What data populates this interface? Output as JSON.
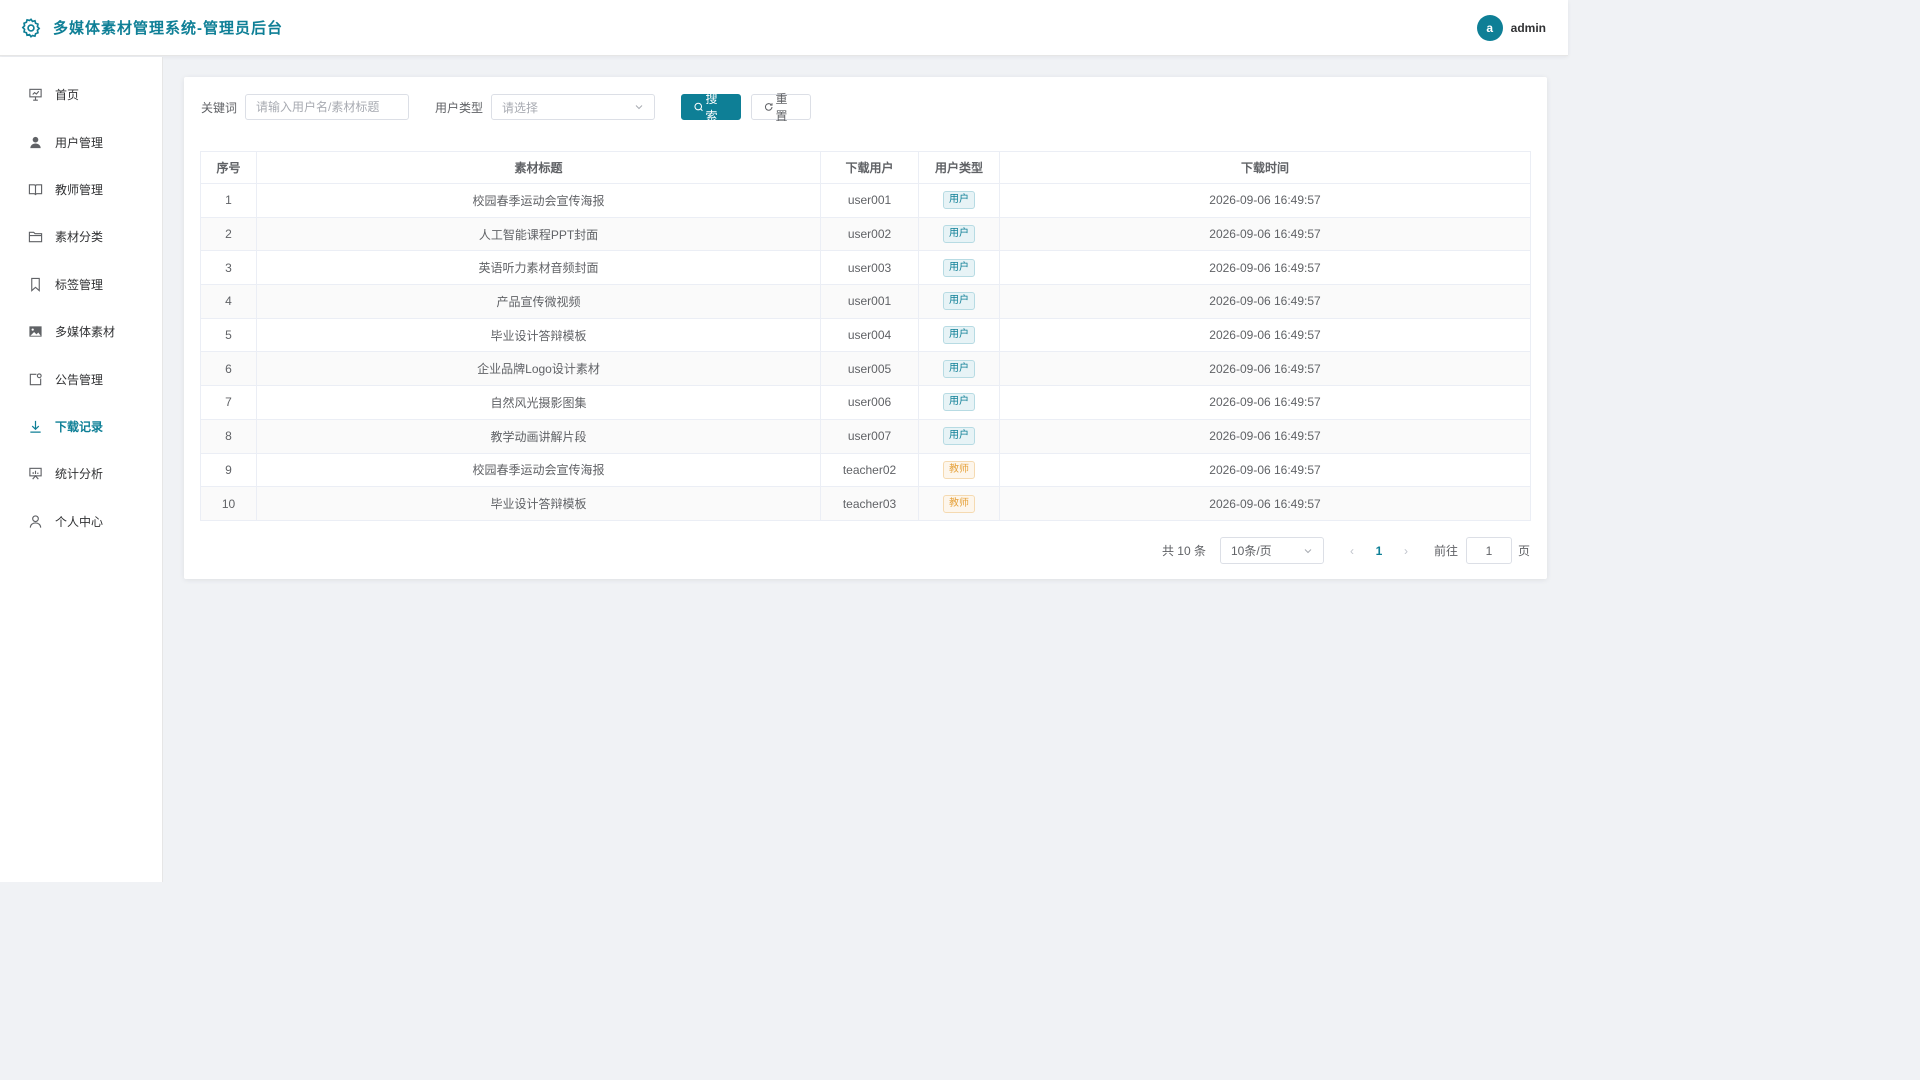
{
  "header": {
    "title": "多媒体素材管理系统-管理员后台",
    "avatar_letter": "a",
    "username": "admin"
  },
  "sidebar": {
    "items": [
      {
        "label": "首页",
        "icon": "presentation-icon"
      },
      {
        "label": "用户管理",
        "icon": "user-icon"
      },
      {
        "label": "教师管理",
        "icon": "book-icon"
      },
      {
        "label": "素材分类",
        "icon": "folder-icon"
      },
      {
        "label": "标签管理",
        "icon": "bookmark-icon"
      },
      {
        "label": "多媒体素材",
        "icon": "image-icon"
      },
      {
        "label": "公告管理",
        "icon": "notice-icon"
      },
      {
        "label": "下载记录",
        "icon": "download-icon",
        "active": true
      },
      {
        "label": "统计分析",
        "icon": "chart-icon"
      },
      {
        "label": "个人中心",
        "icon": "person-icon"
      }
    ]
  },
  "filter": {
    "keyword_label": "关键词",
    "keyword_placeholder": "请输入用户名/素材标题",
    "usertype_label": "用户类型",
    "usertype_placeholder": "请选择",
    "search_label": "搜索",
    "reset_label": "重置"
  },
  "table": {
    "columns": [
      "序号",
      "素材标题",
      "下载用户",
      "用户类型",
      "下载时间"
    ],
    "rows": [
      {
        "index": "1",
        "title": "校园春季运动会宣传海报",
        "user": "user001",
        "type": "用户",
        "time": "2026-09-06 16:49:57"
      },
      {
        "index": "2",
        "title": "人工智能课程PPT封面",
        "user": "user002",
        "type": "用户",
        "time": "2026-09-06 16:49:57"
      },
      {
        "index": "3",
        "title": "英语听力素材音频封面",
        "user": "user003",
        "type": "用户",
        "time": "2026-09-06 16:49:57"
      },
      {
        "index": "4",
        "title": "产品宣传微视频",
        "user": "user001",
        "type": "用户",
        "time": "2026-09-06 16:49:57"
      },
      {
        "index": "5",
        "title": "毕业设计答辩模板",
        "user": "user004",
        "type": "用户",
        "time": "2026-09-06 16:49:57"
      },
      {
        "index": "6",
        "title": "企业品牌Logo设计素材",
        "user": "user005",
        "type": "用户",
        "time": "2026-09-06 16:49:57"
      },
      {
        "index": "7",
        "title": "自然风光摄影图集",
        "user": "user006",
        "type": "用户",
        "time": "2026-09-06 16:49:57"
      },
      {
        "index": "8",
        "title": "教学动画讲解片段",
        "user": "user007",
        "type": "用户",
        "time": "2026-09-06 16:49:57"
      },
      {
        "index": "9",
        "title": "校园春季运动会宣传海报",
        "user": "teacher02",
        "type": "教师",
        "time": "2026-09-06 16:49:57"
      },
      {
        "index": "10",
        "title": "毕业设计答辩模板",
        "user": "teacher03",
        "type": "教师",
        "time": "2026-09-06 16:49:57"
      }
    ]
  },
  "pagination": {
    "total": "共 10 条",
    "page_size": "10条/页",
    "current_page": "1",
    "goto_label": "前往",
    "goto_value": "1",
    "page_suffix": "页"
  },
  "colors": {
    "accent": "#0e7f96",
    "teacher_tag": "#e6a23c"
  }
}
